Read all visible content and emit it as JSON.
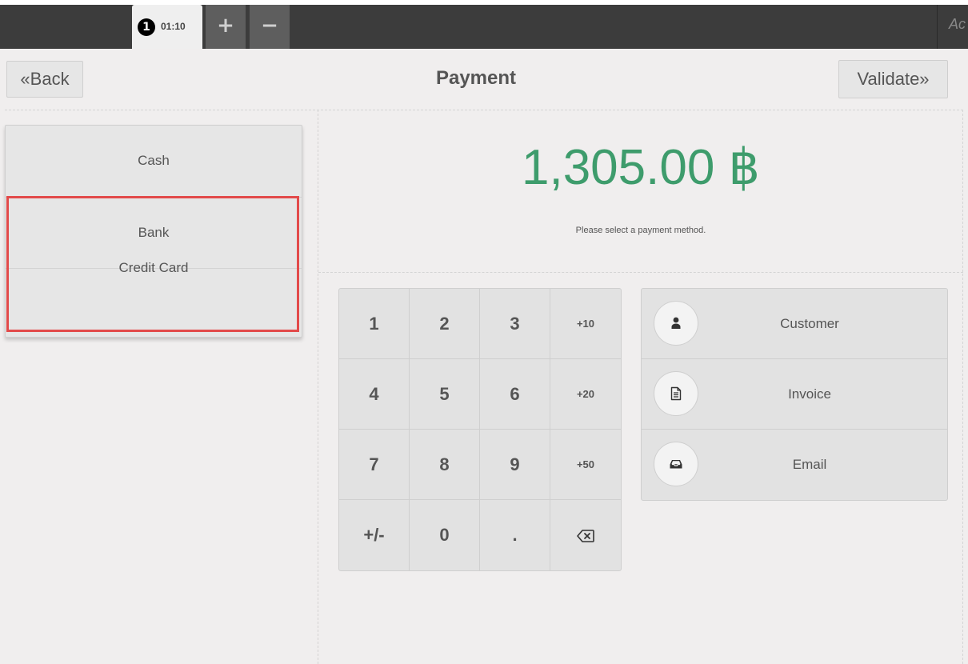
{
  "topbar": {
    "order_number": "1",
    "order_time": "01:10",
    "add_order_label": "+",
    "remove_order_label": "−",
    "user_label": "Ac"
  },
  "header": {
    "back_label": "«Back",
    "title": "Payment",
    "validate_label": "Validate»"
  },
  "payment_methods": [
    "Cash",
    "Bank",
    "Credit Card"
  ],
  "amount": {
    "value": "1,305.00 ฿",
    "hint": "Please select a payment method."
  },
  "numpad": {
    "keys": [
      "1",
      "2",
      "3",
      "+10",
      "4",
      "5",
      "6",
      "+20",
      "7",
      "8",
      "9",
      "+50",
      "+/-",
      "0",
      ".",
      "⌫"
    ]
  },
  "actions": [
    {
      "label": "Customer",
      "icon": "user-icon"
    },
    {
      "label": "Invoice",
      "icon": "file-icon"
    },
    {
      "label": "Email",
      "icon": "inbox-icon"
    }
  ],
  "colors": {
    "amount": "#3e9c6c",
    "highlight": "#e24a4a",
    "topbar": "#3c3c3c"
  }
}
